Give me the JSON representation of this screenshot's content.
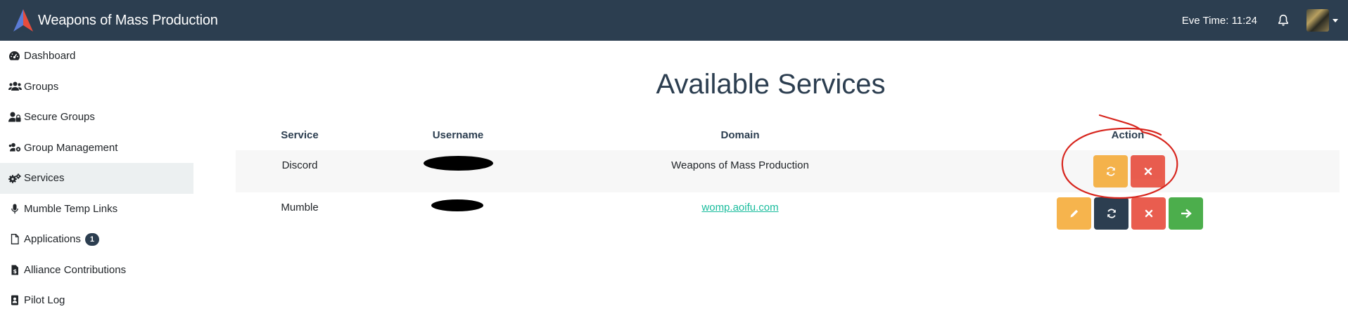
{
  "navbar": {
    "brand_title": "Weapons of Mass Production",
    "eve_time": "Eve Time: 11:24"
  },
  "sidebar": {
    "items": [
      {
        "label": "Dashboard",
        "icon": "dashboard-icon"
      },
      {
        "label": "Groups",
        "icon": "users-icon"
      },
      {
        "label": "Secure Groups",
        "icon": "user-lock-icon"
      },
      {
        "label": "Group Management",
        "icon": "users-cog-icon"
      },
      {
        "label": "Services",
        "icon": "cogs-icon",
        "active": true
      },
      {
        "label": "Mumble Temp Links",
        "icon": "microphone-icon"
      },
      {
        "label": "Applications",
        "icon": "file-icon",
        "badge": "1"
      },
      {
        "label": "Alliance Contributions",
        "icon": "file-invoice-icon"
      },
      {
        "label": "Pilot Log",
        "icon": "address-book-icon"
      }
    ]
  },
  "main": {
    "title": "Available Services",
    "table": {
      "headers": {
        "service": "Service",
        "username": "Username",
        "domain": "Domain",
        "action": "Action"
      },
      "rows": [
        {
          "service": "Discord",
          "domain": "Weapons of Mass Production",
          "domain_is_link": false,
          "actions": [
            "refresh",
            "delete"
          ]
        },
        {
          "service": "Mumble",
          "domain": "womp.aoifu.com",
          "domain_is_link": true,
          "actions": [
            "edit",
            "refresh",
            "delete",
            "open"
          ]
        }
      ]
    }
  },
  "colors": {
    "navbar": "#2c3e50",
    "warning": "#f39c12",
    "danger": "#e74c3c",
    "success": "#4cae4c",
    "link": "#18bc9c",
    "annotation": "#d7261e"
  }
}
